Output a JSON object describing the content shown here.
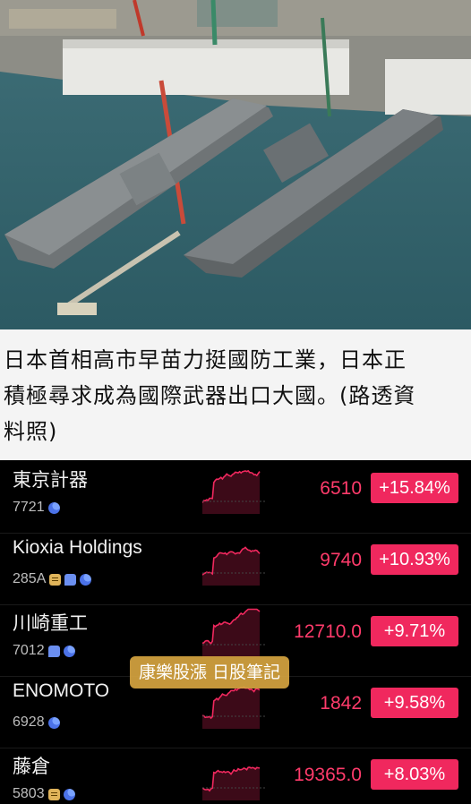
{
  "caption": {
    "line1": "日本首相高市早苗力挺國防工業，日本正",
    "line2": "積極尋求成為國際武器出口大國。(路透資",
    "line3": "料照)"
  },
  "watermark": "康樂股漲 日股筆記",
  "colors": {
    "up": "#ff3b6b",
    "badge_up": "#f0285e",
    "background_dark": "#000000",
    "caption_bg": "#f4f4f4"
  },
  "stocks": [
    {
      "name": "東京計器",
      "code": "7721",
      "icons": [
        "pie-icon"
      ],
      "price": "6510",
      "change": "+15.84%"
    },
    {
      "name": "Kioxia Holdings",
      "code": "285A",
      "icons": [
        "note-icon",
        "chat-icon",
        "pie-icon"
      ],
      "price": "9740",
      "change": "+10.93%"
    },
    {
      "name": "川崎重工",
      "code": "7012",
      "icons": [
        "chat-icon",
        "pie-icon"
      ],
      "price": "12710.0",
      "change": "+9.71%"
    },
    {
      "name": "ENOMOTO",
      "code": "6928",
      "icons": [
        "pie-icon"
      ],
      "price": "1842",
      "change": "+9.58%"
    },
    {
      "name": "藤倉",
      "code": "5803",
      "icons": [
        "note-icon",
        "pie-icon"
      ],
      "price": "19365.0",
      "change": "+8.03%"
    }
  ]
}
